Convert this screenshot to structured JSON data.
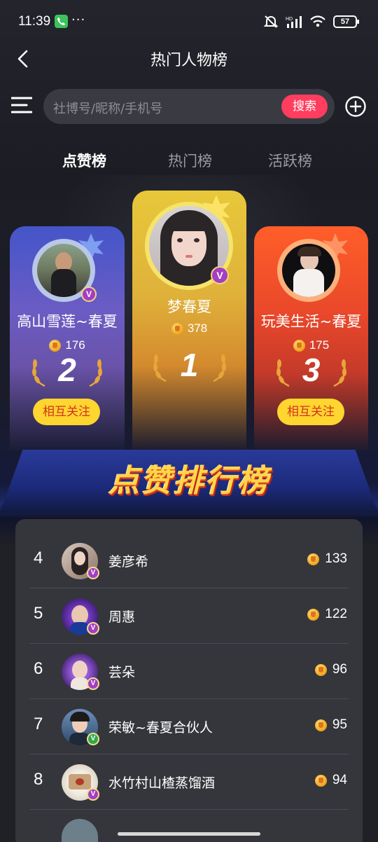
{
  "status_bar": {
    "time": "11:39",
    "dots": "···",
    "battery": "57"
  },
  "header": {
    "title": "热门人物榜"
  },
  "search": {
    "placeholder": "社博号/昵称/手机号",
    "button": "搜索"
  },
  "tabs": [
    {
      "label": "点赞榜",
      "active": true
    },
    {
      "label": "热门榜",
      "active": false
    },
    {
      "label": "活跃榜",
      "active": false
    }
  ],
  "podium": [
    {
      "rank": "1",
      "name": "梦春夏",
      "likes": "378",
      "badge": "V"
    },
    {
      "rank": "2",
      "name": "高山雪莲~春夏",
      "likes": "176",
      "badge": "V",
      "follow": "相互关注"
    },
    {
      "rank": "3",
      "name": "玩美生活~春夏",
      "likes": "175",
      "follow": "相互关注"
    }
  ],
  "banner": {
    "title": "点赞排行榜"
  },
  "list": [
    {
      "rank": "4",
      "name": "姜彦希",
      "likes": "133",
      "badge": "V"
    },
    {
      "rank": "5",
      "name": "周惠",
      "likes": "122",
      "badge": "V"
    },
    {
      "rank": "6",
      "name": "芸朵",
      "likes": "96",
      "badge": "V"
    },
    {
      "rank": "7",
      "name": "荣敏~春夏合伙人",
      "likes": "95",
      "badge": "V"
    },
    {
      "rank": "8",
      "name": "水竹村山楂蒸馏酒",
      "likes": "94",
      "badge": "V"
    }
  ],
  "colors": {
    "accent": "#ff3d5f",
    "follow_bg": "#ffd52f",
    "follow_text": "#d2331f",
    "gold": "#e8c83a",
    "badge": "#a43ec4"
  }
}
